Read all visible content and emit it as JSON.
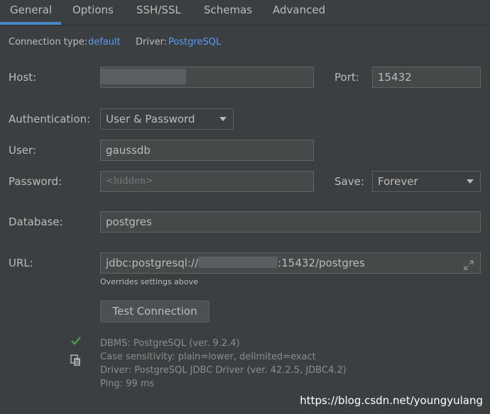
{
  "tabs": [
    {
      "label": "General"
    },
    {
      "label": "Options"
    },
    {
      "label": "SSH/SSL"
    },
    {
      "label": "Schemas"
    },
    {
      "label": "Advanced"
    }
  ],
  "conn_info": {
    "type_label": "Connection type:",
    "type_value": "default",
    "driver_label": "Driver:",
    "driver_value": "PostgreSQL"
  },
  "form": {
    "host_label": "Host:",
    "port_label": "Port:",
    "port_value": "15432",
    "auth_label": "Authentication:",
    "auth_value": "User & Password",
    "user_label": "User:",
    "user_value": "gaussdb",
    "password_label": "Password:",
    "password_placeholder": "<hidden>",
    "save_label": "Save:",
    "save_value": "Forever",
    "database_label": "Database:",
    "database_value": "postgres",
    "url_label": "URL:",
    "url_prefix": "jdbc:postgresql://",
    "url_suffix": ":15432/postgres",
    "url_hint": "Overrides settings above"
  },
  "test": {
    "button_label": "Test Connection",
    "lines": [
      "DBMS: PostgreSQL (ver. 9.2.4)",
      "Case sensitivity: plain=lower, delimited=exact",
      "Driver: PostgreSQL JDBC Driver (ver. 42.2.5, JDBC4.2)",
      "Ping: 99 ms"
    ]
  },
  "watermark": "https://blog.csdn.net/youngyulang",
  "colors": {
    "background": "#3c3f41",
    "link": "#589df6",
    "tab_underline": "#4a88c7",
    "success": "#499c54"
  },
  "icons": {
    "success": "check-icon",
    "copy": "copy-icon",
    "expand": "expand-icon"
  }
}
